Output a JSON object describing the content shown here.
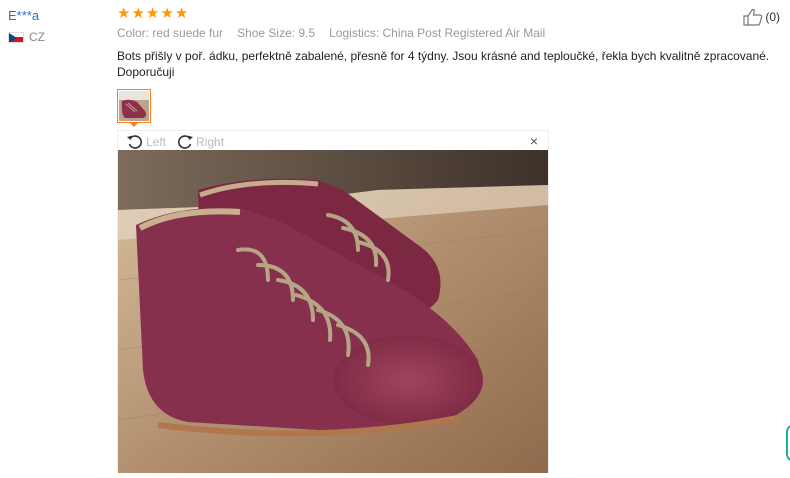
{
  "reviewer": {
    "name": "E***a",
    "country": "CZ"
  },
  "review": {
    "rating_stars": 5,
    "stars": [
      "★",
      "★",
      "★",
      "★",
      "★"
    ],
    "meta": [
      "Color: red suede fur",
      "Shoe Size: 9.5",
      "Logistics: China Post Registered Air Mail"
    ],
    "text": "Bots přišly v poř. ádku, perfektně zabalené, přesně for 4 týdny. Jsou krásné and teploučké, řekla bych kvalitně zpracované. Doporučuji"
  },
  "helpful": {
    "count": "(0)",
    "icon": "thumbs-up-icon"
  },
  "viewer": {
    "rotate_left": "Left",
    "rotate_right": "Right",
    "close": "×"
  },
  "colors": {
    "accent": "#ff7d1f",
    "star": "#ff9900",
    "name_link": "#2f6fcf"
  }
}
